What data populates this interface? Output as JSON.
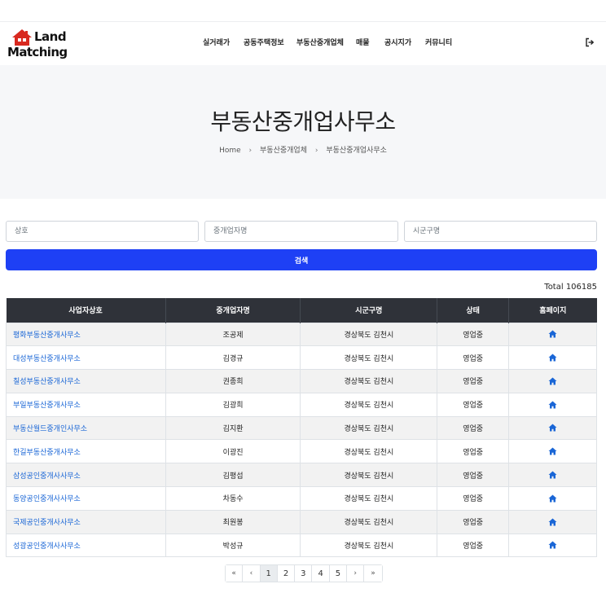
{
  "brand": {
    "line1": "Land",
    "line2": "Matching"
  },
  "nav": {
    "items": [
      {
        "label": "실거래가"
      },
      {
        "label": "공동주택정보"
      },
      {
        "label": "부동산중개업체"
      },
      {
        "label": "매물"
      },
      {
        "label": "공시지가"
      },
      {
        "label": "커뮤니티"
      }
    ],
    "logout_icon": "sign-out-icon"
  },
  "hero": {
    "title": "부동산중개업사무소",
    "breadcrumb": [
      "Home",
      "부동산중개업체",
      "부동산중개업사무소"
    ],
    "separator": "›"
  },
  "search": {
    "business_placeholder": "상호",
    "broker_placeholder": "중개업자명",
    "region_placeholder": "시군구명",
    "button_label": "검색"
  },
  "total_label": "Total 106185",
  "table": {
    "headers": [
      "사업자상호",
      "중개업자명",
      "시군구명",
      "상태",
      "홈페이지"
    ],
    "rows": [
      {
        "name": "평화부동산중개사무소",
        "broker": "조공제",
        "region": "경상북도 김천시",
        "status": "영업중"
      },
      {
        "name": "대성부동산중개사무소",
        "broker": "김경규",
        "region": "경상북도 김천시",
        "status": "영업중"
      },
      {
        "name": "칠성부동산중개사무소",
        "broker": "권종희",
        "region": "경상북도 김천시",
        "status": "영업중"
      },
      {
        "name": "부일부동산중개사무소",
        "broker": "김광희",
        "region": "경상북도 김천시",
        "status": "영업중"
      },
      {
        "name": "부동산월드중개인사무소",
        "broker": "김지환",
        "region": "경상북도 김천시",
        "status": "영업중"
      },
      {
        "name": "한길부동산중개사무소",
        "broker": "이광진",
        "region": "경상북도 김천시",
        "status": "영업중"
      },
      {
        "name": "삼성공인중개사사무소",
        "broker": "김평섭",
        "region": "경상북도 김천시",
        "status": "영업중"
      },
      {
        "name": "동양공인중개사사무소",
        "broker": "차동수",
        "region": "경상북도 김천시",
        "status": "영업중"
      },
      {
        "name": "국제공인중개사사무소",
        "broker": "최원봉",
        "region": "경상북도 김천시",
        "status": "영업중"
      },
      {
        "name": "성광공인중개사사무소",
        "broker": "박성규",
        "region": "경상북도 김천시",
        "status": "영업중"
      }
    ],
    "homepage_icon": "home-icon"
  },
  "pagination": {
    "first": "«",
    "prev": "‹",
    "pages": [
      "1",
      "2",
      "3",
      "4",
      "5"
    ],
    "active": "1",
    "next": "›",
    "last": "»"
  },
  "colors": {
    "accent": "#1e40f5",
    "link": "#1a66d6",
    "table_header": "#2f3239",
    "logo_house": "#d8291f"
  }
}
